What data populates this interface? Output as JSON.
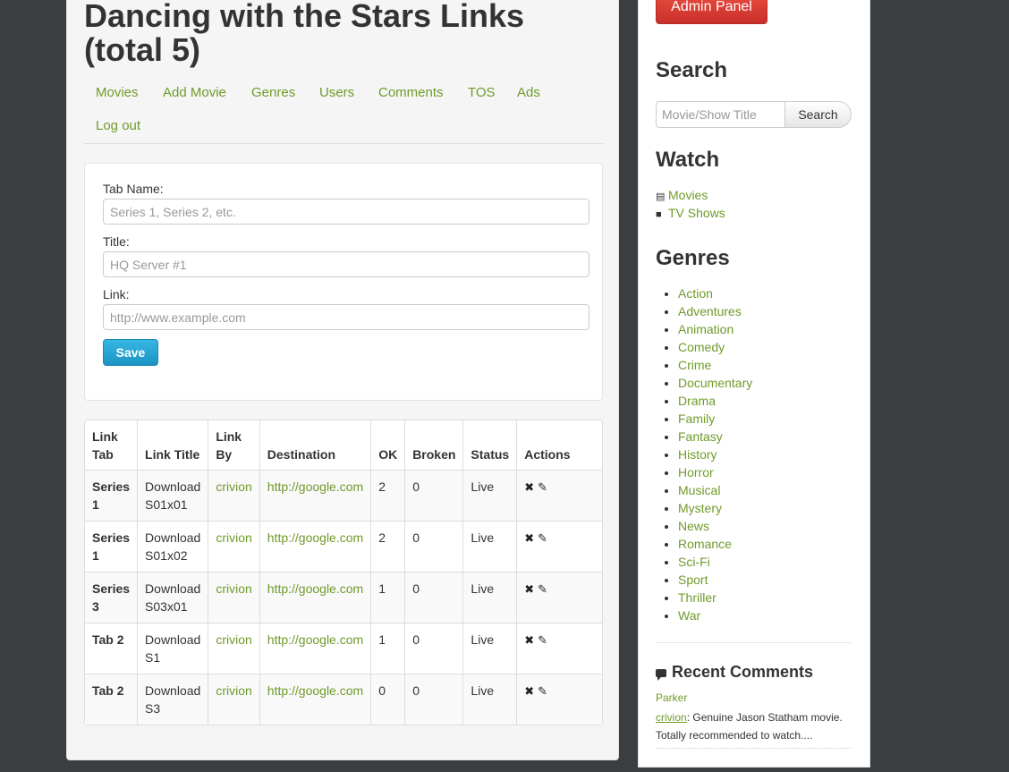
{
  "page": {
    "title": "Dancing with the Stars Links (total 5)"
  },
  "nav": {
    "items": [
      "Movies",
      "Add Movie",
      "Genres",
      "Users",
      "Comments",
      "TOS",
      "Ads",
      "Log out"
    ]
  },
  "form": {
    "tab_name_label": "Tab Name:",
    "tab_name_placeholder": "Series 1, Series 2, etc.",
    "title_label": "Title:",
    "title_placeholder": "HQ Server #1",
    "link_label": "Link:",
    "link_placeholder": "http://www.example.com",
    "save_label": "Save"
  },
  "table": {
    "headers": [
      "Link Tab",
      "Link Title",
      "Link By",
      "Destination",
      "OK",
      "Broken",
      "Status",
      "Actions"
    ],
    "rows": [
      {
        "tab": "Series 1",
        "title": "Download S01x01",
        "by": "crivion",
        "destination": "http://google.com",
        "ok": "2",
        "broken": "0",
        "status": "Live"
      },
      {
        "tab": "Series 1",
        "title": "Download S01x02",
        "by": "crivion",
        "destination": "http://google.com",
        "ok": "2",
        "broken": "0",
        "status": "Live"
      },
      {
        "tab": "Series 3",
        "title": "Download S03x01",
        "by": "crivion",
        "destination": "http://google.com",
        "ok": "1",
        "broken": "0",
        "status": "Live"
      },
      {
        "tab": "Tab 2",
        "title": "Download S1",
        "by": "crivion",
        "destination": "http://google.com",
        "ok": "1",
        "broken": "0",
        "status": "Live"
      },
      {
        "tab": "Tab 2",
        "title": "Download S3",
        "by": "crivion",
        "destination": "http://google.com",
        "ok": "0",
        "broken": "0",
        "status": "Live"
      }
    ],
    "delete_glyph": "✖",
    "edit_glyph": "✎"
  },
  "sidebar": {
    "admin_button": "Admin Panel",
    "search_heading": "Search",
    "search_placeholder": "Movie/Show Title",
    "search_button": "Search",
    "watch_heading": "Watch",
    "watch_items": [
      {
        "label": "Movies",
        "icon": "film-icon"
      },
      {
        "label": "TV Shows",
        "icon": "video-camera-icon"
      }
    ],
    "genres_heading": "Genres",
    "genres": [
      "Action",
      "Adventures",
      "Animation",
      "Comedy",
      "Crime",
      "Documentary",
      "Drama",
      "Family",
      "Fantasy",
      "History",
      "Horror",
      "Musical",
      "Mystery",
      "News",
      "Romance",
      "Sci-Fi",
      "Sport",
      "Thriller",
      "War"
    ],
    "recent_comments_heading": "Recent Comments",
    "comment_author": "Parker",
    "comment_user": "crivion",
    "comment_text": ": Genuine Jason Statham movie. Totally recommended to watch...."
  },
  "colors": {
    "link": "#6f9b2a",
    "background": "#3a3e41",
    "save_button": "#1b93c4",
    "admin_button": "#c9302c"
  }
}
